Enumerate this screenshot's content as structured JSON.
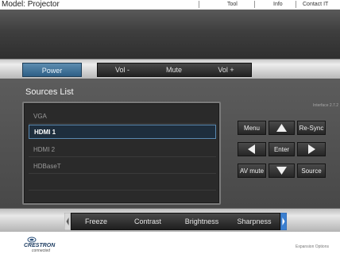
{
  "header": {
    "model_label": "Model: Projector",
    "links": [
      "Tool",
      "Info",
      "Contact IT Help"
    ]
  },
  "controls": {
    "power": "Power",
    "vol_minus": "Vol -",
    "mute": "Mute",
    "vol_plus": "Vol +"
  },
  "panel": {
    "interface_version": "Interface 2.7.2",
    "sources_title": "Sources List",
    "sources": [
      "VGA",
      "HDMI 1",
      "HDMI 2",
      "HDBaseT"
    ],
    "selected_source": "HDMI 1"
  },
  "pad": {
    "menu": "Menu",
    "resync": "Re-Sync",
    "enter": "Enter",
    "av_mute": "AV mute",
    "source": "Source"
  },
  "bottom": {
    "buttons": [
      "Freeze",
      "Contrast",
      "Brightness",
      "Sharpness"
    ]
  },
  "footer": {
    "logo_text": "CRESTRON",
    "logo_subtext": "connected",
    "expansion": "Expansion Options"
  },
  "colors": {
    "accent_blue": "#2e5f86",
    "selected_border": "#5a89b0",
    "tab_blue": "#3b7fd0"
  }
}
